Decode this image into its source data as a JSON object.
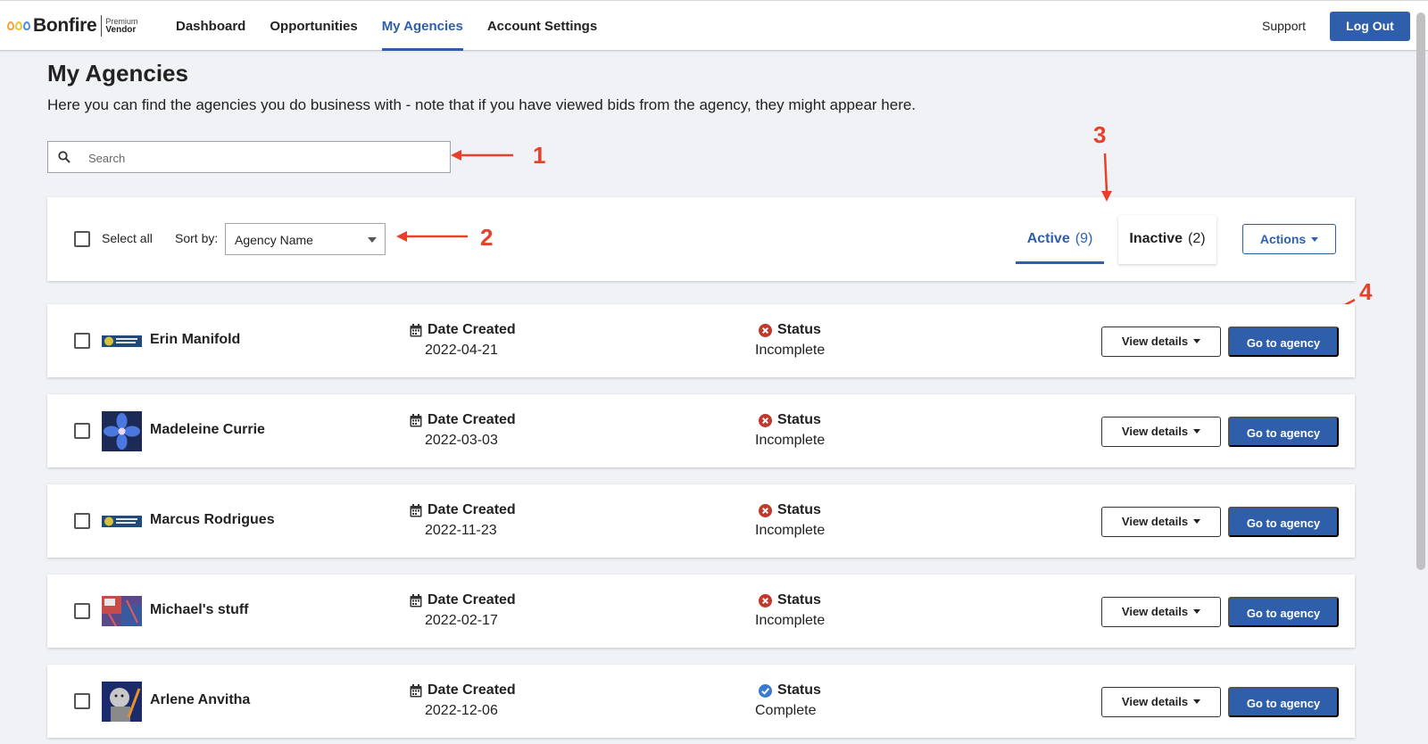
{
  "header": {
    "logo_word": "Bonfire",
    "logo_tier_top": "Premium",
    "logo_tier_bottom": "Vendor",
    "nav": [
      {
        "label": "Dashboard"
      },
      {
        "label": "Opportunities"
      },
      {
        "label": "My Agencies"
      },
      {
        "label": "Account Settings"
      }
    ],
    "active_nav": "My Agencies",
    "support_label": "Support",
    "logout_label": "Log Out"
  },
  "page": {
    "title": "My Agencies",
    "description": "Here you can find the agencies you do business with - note that if you have viewed bids from the agency, they might appear here."
  },
  "search": {
    "placeholder": "Search",
    "value": ""
  },
  "toolbar": {
    "select_all_label": "Select all",
    "sort_label": "Sort by:",
    "sort_value": "Agency Name",
    "tabs": [
      {
        "label": "Active",
        "count": "(9)",
        "active": true
      },
      {
        "label": "Inactive",
        "count": "(2)",
        "active": false
      }
    ],
    "actions_label": "Actions"
  },
  "annotations": [
    "1",
    "2",
    "3",
    "4"
  ],
  "row_labels": {
    "date_heading": "Date Created",
    "status_heading": "Status",
    "view_details": "View details",
    "go_to_agency": "Go to agency"
  },
  "agencies": [
    {
      "name": "Erin Manifold",
      "date": "2022-04-21",
      "status": "Incomplete",
      "status_type": "error",
      "thumb": "demo-college-banner"
    },
    {
      "name": "Madeleine Currie",
      "date": "2022-03-03",
      "status": "Incomplete",
      "status_type": "error",
      "thumb": "blue-flower"
    },
    {
      "name": "Marcus Rodrigues",
      "date": "2022-11-23",
      "status": "Incomplete",
      "status_type": "error",
      "thumb": "demo-college-banner"
    },
    {
      "name": "Michael's stuff",
      "date": "2022-02-17",
      "status": "Incomplete",
      "status_type": "error",
      "thumb": "collage"
    },
    {
      "name": "Arlene Anvitha",
      "date": "2022-12-06",
      "status": "Complete",
      "status_type": "success",
      "thumb": "meme-portrait"
    }
  ],
  "colors": {
    "brand_blue": "#2f5fab",
    "error_red": "#c0392b",
    "success_blue": "#3a78d6",
    "annotation_red": "#e8402b"
  }
}
